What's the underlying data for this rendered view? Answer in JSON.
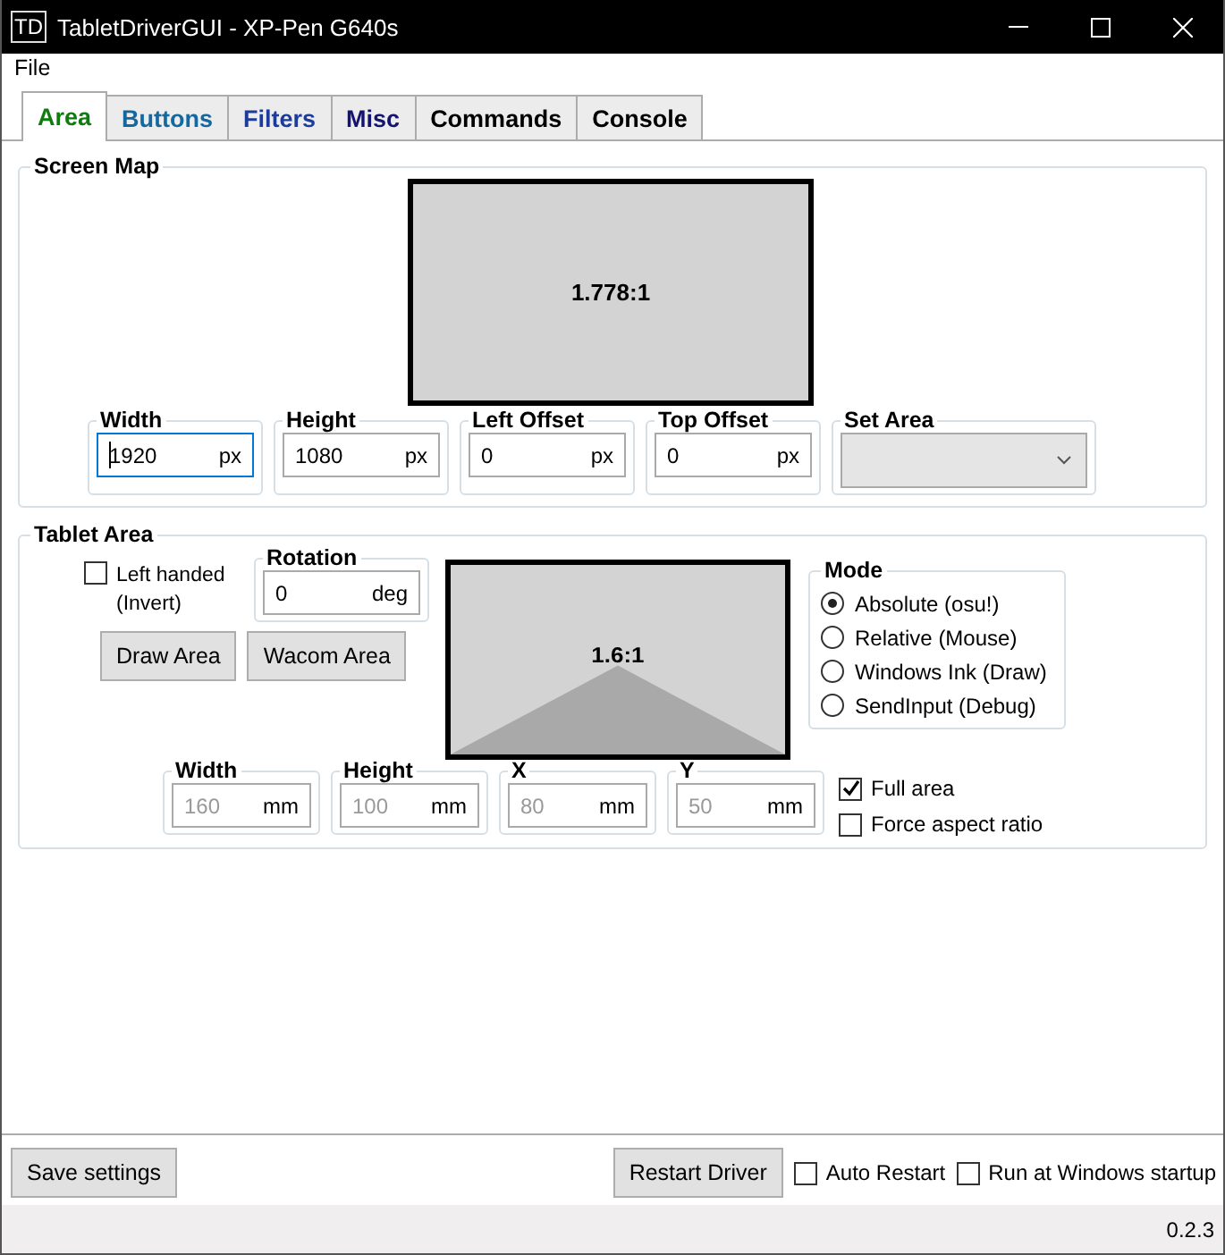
{
  "window": {
    "title": "TabletDriverGUI - XP-Pen G640s",
    "icon_text": "TD"
  },
  "menu": [
    "File"
  ],
  "tabs": [
    {
      "label": "Area",
      "selected": true,
      "color": "#107c10"
    },
    {
      "label": "Buttons",
      "selected": false,
      "color": "#1468a0"
    },
    {
      "label": "Filters",
      "selected": false,
      "color": "#1c3c9c"
    },
    {
      "label": "Misc",
      "selected": false,
      "color": "#141470"
    },
    {
      "label": "Commands",
      "selected": false,
      "color": "#000000"
    },
    {
      "label": "Console",
      "selected": false,
      "color": "#000000"
    }
  ],
  "screen_map": {
    "title": "Screen Map",
    "ratio": "1.778:1",
    "fields": [
      {
        "label": "Width",
        "value": "1920",
        "unit": "px",
        "focused": true,
        "disabled": false
      },
      {
        "label": "Height",
        "value": "1080",
        "unit": "px",
        "focused": false,
        "disabled": false
      },
      {
        "label": "Left Offset",
        "value": "0",
        "unit": "px",
        "focused": false,
        "disabled": false
      },
      {
        "label": "Top Offset",
        "value": "0",
        "unit": "px",
        "focused": false,
        "disabled": false
      }
    ],
    "set_area": {
      "label": "Set Area"
    }
  },
  "tablet_area": {
    "title": "Tablet Area",
    "left_handed": {
      "label": "Left handed (Invert)",
      "checked": false
    },
    "rotation": {
      "label": "Rotation",
      "value": "0",
      "unit": "deg",
      "focused": false,
      "disabled": false
    },
    "buttons": [
      "Draw Area",
      "Wacom Area"
    ],
    "ratio": "1.6:1",
    "mode": {
      "title": "Mode",
      "options": [
        {
          "label": "Absolute (osu!)",
          "selected": true
        },
        {
          "label": "Relative (Mouse)",
          "selected": false
        },
        {
          "label": "Windows Ink (Draw)",
          "selected": false
        },
        {
          "label": "SendInput (Debug)",
          "selected": false
        }
      ]
    },
    "fields": [
      {
        "label": "Width",
        "value": "160",
        "unit": "mm",
        "focused": false,
        "disabled": true
      },
      {
        "label": "Height",
        "value": "100",
        "unit": "mm",
        "focused": false,
        "disabled": true
      },
      {
        "label": "X",
        "value": "80",
        "unit": "mm",
        "focused": false,
        "disabled": true
      },
      {
        "label": "Y",
        "value": "50",
        "unit": "mm",
        "focused": false,
        "disabled": true
      }
    ],
    "options": [
      {
        "label": "Full area",
        "checked": true
      },
      {
        "label": "Force aspect ratio",
        "checked": false
      }
    ]
  },
  "footer": {
    "save_button": "Save settings",
    "restart_button": "Restart Driver",
    "options": [
      {
        "label": "Auto Restart",
        "checked": false
      },
      {
        "label": "Run at Windows startup",
        "checked": false
      }
    ]
  },
  "status_bar": {
    "version": "0.2.3"
  }
}
